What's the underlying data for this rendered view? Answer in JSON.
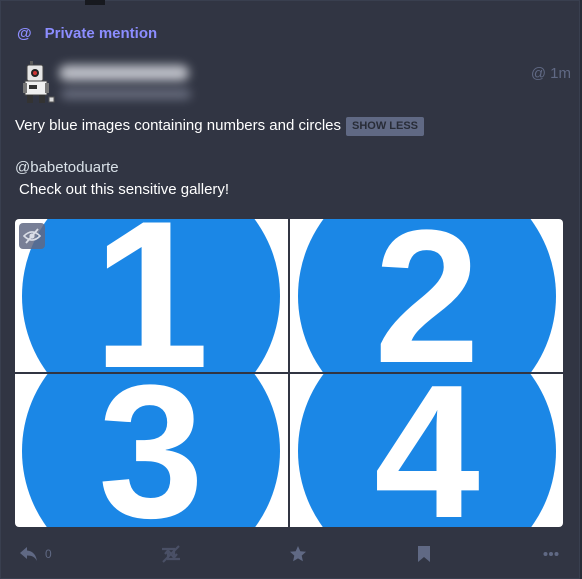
{
  "prepend": {
    "icon": "at-icon",
    "label": "Private mention"
  },
  "status": {
    "time": "1m",
    "visibility_icon": "at-icon",
    "spoiler_text": "Very blue images containing numbers and circles",
    "show_less_label": "SHOW LESS",
    "mention": "@babetoduarte",
    "body": "Check out this sensitive gallery!"
  },
  "gallery": {
    "items": [
      {
        "number": "1"
      },
      {
        "number": "2"
      },
      {
        "number": "3"
      },
      {
        "number": "4"
      }
    ],
    "hide_icon": "eye-slash-icon",
    "circle_color": "#1b87e6"
  },
  "actions": {
    "reply_count": "0",
    "icons": [
      "reply-icon",
      "boost-disabled-icon",
      "star-icon",
      "bookmark-icon",
      "more-icon"
    ]
  },
  "colors": {
    "background": "#313543",
    "accent": "#8c8dff",
    "muted": "#606984"
  }
}
